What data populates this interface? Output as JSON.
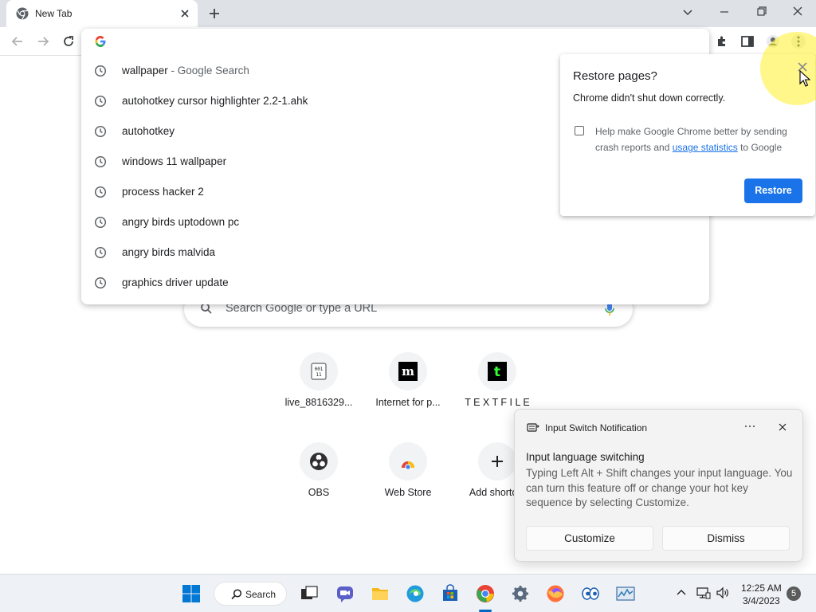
{
  "browser": {
    "tab_title": "New Tab",
    "address_value": ""
  },
  "omnibox": {
    "suggestions": [
      {
        "text": "wallpaper",
        "suffix": " - Google Search"
      },
      {
        "text": "autohotkey cursor highlighter 2.2-1.ahk",
        "suffix": ""
      },
      {
        "text": "autohotkey",
        "suffix": ""
      },
      {
        "text": "windows 11 wallpaper",
        "suffix": ""
      },
      {
        "text": "process hacker 2",
        "suffix": ""
      },
      {
        "text": "angry birds uptodown pc",
        "suffix": ""
      },
      {
        "text": "angry birds malvida",
        "suffix": ""
      },
      {
        "text": "graphics driver update",
        "suffix": ""
      }
    ]
  },
  "ntp": {
    "search_placeholder": "Search Google or type a URL",
    "shortcuts": [
      {
        "label": "live_8816329...",
        "icon": "binary-file-icon"
      },
      {
        "label": "Internet for p...",
        "icon": "m-logo-icon"
      },
      {
        "label": "T E X T F I L E",
        "icon": "t-logo-icon"
      },
      {
        "label": "OBS",
        "icon": "obs-icon"
      },
      {
        "label": "Web Store",
        "icon": "webstore-icon"
      },
      {
        "label": "Add shortcut",
        "icon": "plus-icon"
      }
    ]
  },
  "restore_bubble": {
    "title": "Restore pages?",
    "message": "Chrome didn't shut down correctly.",
    "help_prefix": "Help make Google Chrome better by sending crash reports and ",
    "help_link": "usage statistics",
    "help_suffix": " to Google",
    "restore_label": "Restore",
    "accent": "#1a73e8"
  },
  "toast": {
    "app_name": "Input Switch Notification",
    "title": "Input language switching",
    "body": "Typing Left Alt + Shift changes your input language. You can turn this feature off or change your hot key sequence by selecting Customize.",
    "customize_label": "Customize",
    "dismiss_label": "Dismiss"
  },
  "taskbar": {
    "search_label": "Search",
    "time": "12:25 AM",
    "date": "3/4/2023",
    "notification_count": "5"
  }
}
